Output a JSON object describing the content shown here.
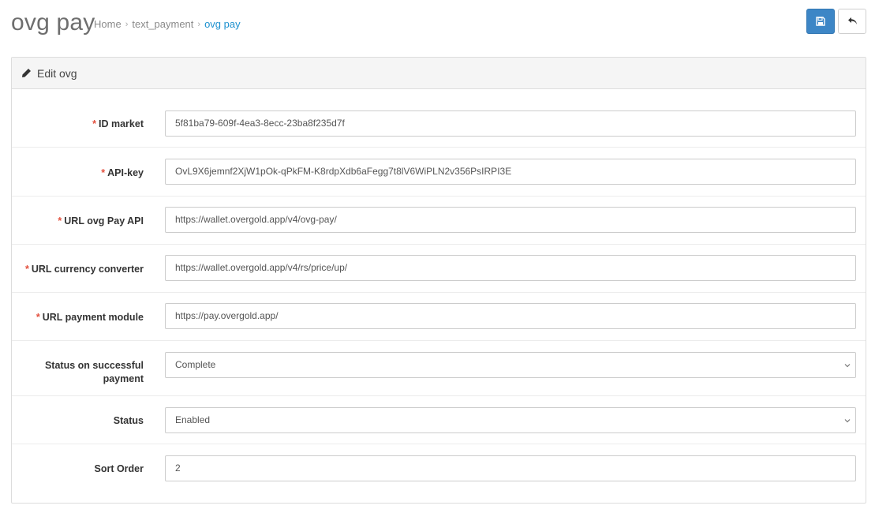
{
  "header": {
    "title": "ovg pay",
    "breadcrumbs": [
      "Home",
      "text_payment",
      "ovg pay"
    ],
    "breadcrumb_separator": "›",
    "save_icon": "floppy-disk-icon",
    "back_icon": "reply-arrow-icon"
  },
  "panel": {
    "heading": "Edit ovg",
    "heading_icon": "pencil-icon"
  },
  "fields": {
    "id_market": {
      "label": "ID market",
      "required_mark": "*",
      "value": "5f81ba79-609f-4ea3-8ecc-23ba8f235d7f"
    },
    "api_key": {
      "label": "API-key",
      "required_mark": "*",
      "value": "OvL9X6jemnf2XjW1pOk-qPkFM-K8rdpXdb6aFegg7t8lV6WiPLN2v356PsIRPI3E"
    },
    "url_api": {
      "label": "URL ovg Pay API",
      "required_mark": "*",
      "value": "https://wallet.overgold.app/v4/ovg-pay/"
    },
    "url_converter": {
      "label": "URL currency converter",
      "required_mark": "*",
      "value": "https://wallet.overgold.app/v4/rs/price/up/"
    },
    "url_module": {
      "label": "URL payment module",
      "required_mark": "*",
      "value": "https://pay.overgold.app/"
    },
    "status_success": {
      "label_line1": "Status on successful",
      "label_line2": "payment",
      "value": "Complete"
    },
    "status": {
      "label": "Status",
      "value": "Enabled"
    },
    "sort_order": {
      "label": "Sort Order",
      "value": "2"
    }
  },
  "colors": {
    "primary": "#3d86c6",
    "required": "#e3503e",
    "breadcrumb_active": "#1e91cf"
  }
}
